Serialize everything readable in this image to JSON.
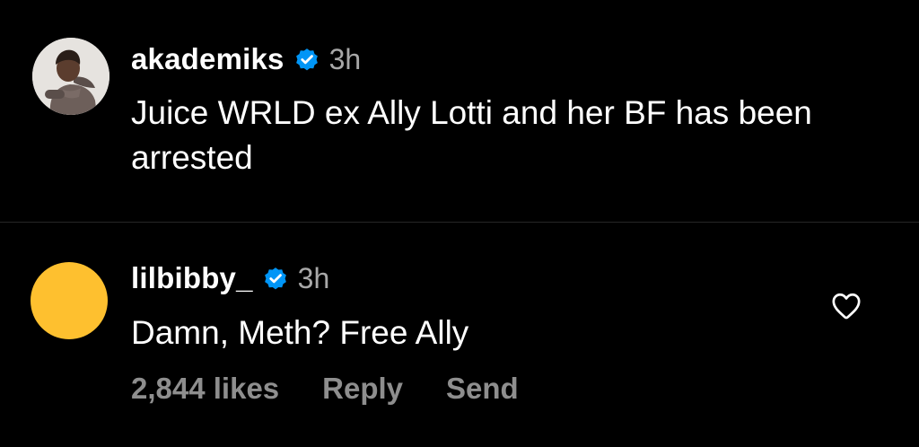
{
  "caption": {
    "username": "akademiks",
    "time": "3h",
    "text": "Juice WRLD ex Ally Lotti and her BF has been arrested"
  },
  "comment": {
    "username": "lilbibby_",
    "time": "3h",
    "text": "Damn, Meth? Free Ally",
    "likes": "2,844 likes",
    "reply_label": "Reply",
    "send_label": "Send",
    "avatar_color": "#fec02f"
  },
  "icons": {
    "verified": "verified-badge-icon",
    "like": "heart-outline-icon"
  },
  "colors": {
    "background": "#000000",
    "verified_blue": "#0095f6",
    "secondary_text": "#8e8e8e",
    "divider": "#262626"
  }
}
